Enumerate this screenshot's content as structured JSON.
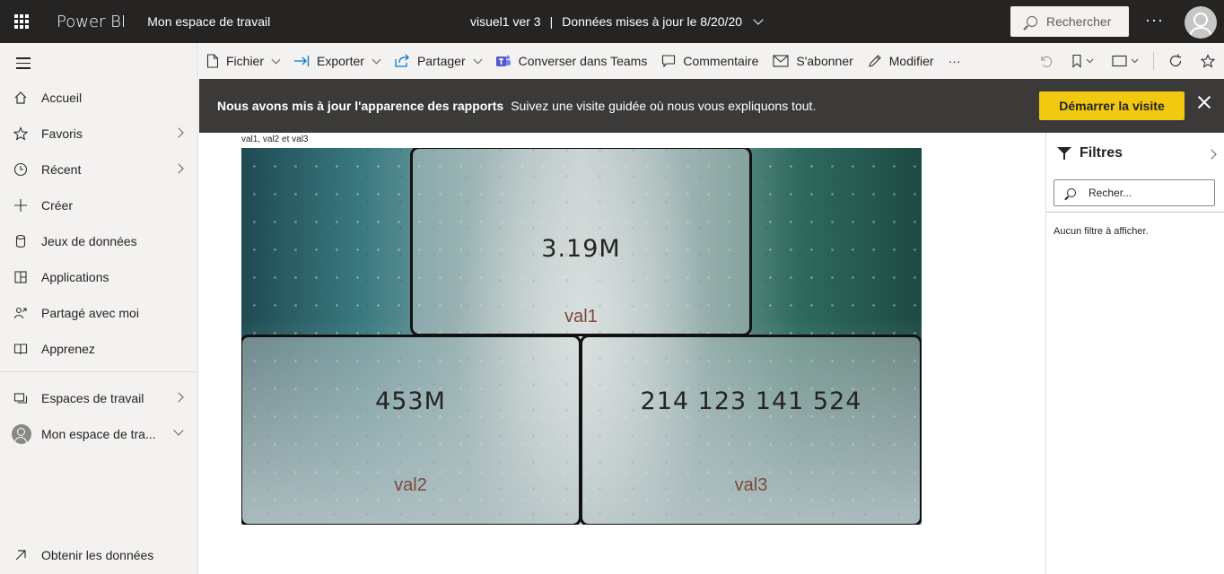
{
  "topbar": {
    "brand": "Power BI",
    "workspace": "Mon espace de travail",
    "report_title": "visuel1 ver 3",
    "separator": "|",
    "updated": "Données mises à jour le 8/20/20",
    "search_placeholder": "Rechercher",
    "more": "···"
  },
  "nav": {
    "items": [
      {
        "label": "Accueil",
        "icon": "home-icon"
      },
      {
        "label": "Favoris",
        "icon": "star-icon"
      },
      {
        "label": "Récent",
        "icon": "clock-icon"
      },
      {
        "label": "Créer",
        "icon": "plus-icon"
      },
      {
        "label": "Jeux de données",
        "icon": "database-icon"
      },
      {
        "label": "Applications",
        "icon": "apps-icon"
      },
      {
        "label": "Partagé avec moi",
        "icon": "shared-icon"
      },
      {
        "label": "Apprenez",
        "icon": "book-icon"
      }
    ],
    "workspaces": "Espaces de travail",
    "my_workspace": "Mon espace de tra...",
    "get_data": "Obtenir les données"
  },
  "toolbar": {
    "file": "Fichier",
    "export": "Exporter",
    "share": "Partager",
    "teams": "Converser dans Teams",
    "comment": "Commentaire",
    "subscribe": "S'abonner",
    "edit": "Modifier",
    "more": "···"
  },
  "banner": {
    "headline": "Nous avons mis à jour l'apparence des rapports",
    "text": "Suivez une visite guidée où nous vous expliquons tout.",
    "button": "Démarrer la visite"
  },
  "report": {
    "visual_title": "val1, val2 et val3",
    "cards": [
      {
        "value": "3.19M",
        "label": "val1"
      },
      {
        "value": "453M",
        "label": "val2"
      },
      {
        "value": "214 123 141 524",
        "label": "val3"
      }
    ]
  },
  "filters": {
    "title": "Filtres",
    "search_placeholder": "Recher...",
    "empty": "Aucun filtre à afficher."
  }
}
